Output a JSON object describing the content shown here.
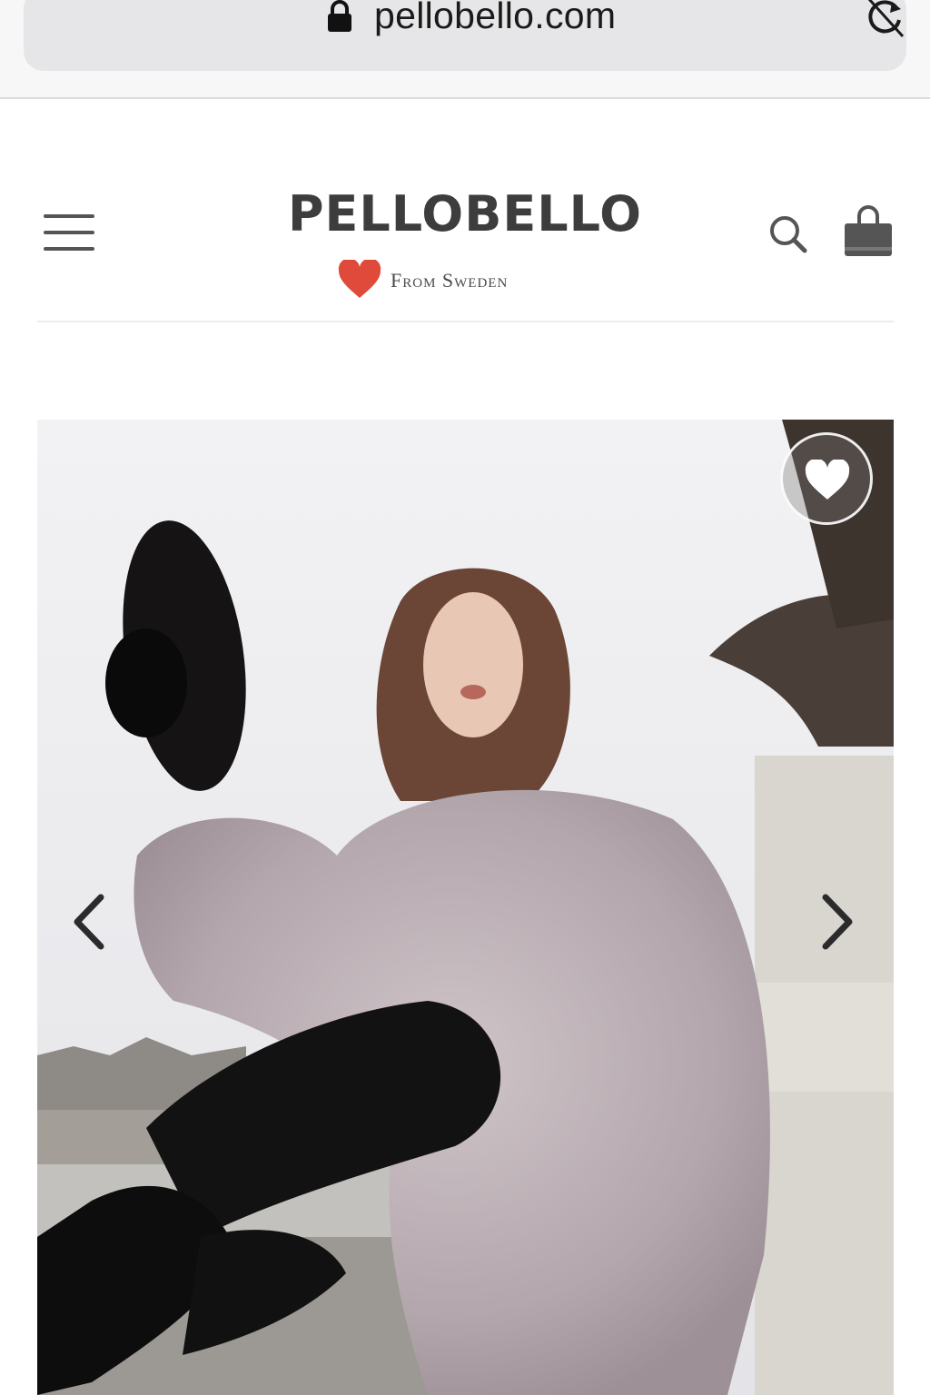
{
  "browser": {
    "url": "pellobello.com",
    "lock_icon": "lock-icon",
    "reload_icon": "reload-icon"
  },
  "header": {
    "menu_icon": "hamburger-menu-icon",
    "logo": "PELLOBELLO",
    "tagline": "From Sweden",
    "heart_icon": "heart-icon",
    "search_icon": "search-icon",
    "cart_icon": "shopping-bag-icon",
    "heart_color": "#e04a3a"
  },
  "product": {
    "wishlist_icon": "heart-icon",
    "prev_icon": "chevron-left-icon",
    "next_icon": "chevron-right-icon"
  }
}
